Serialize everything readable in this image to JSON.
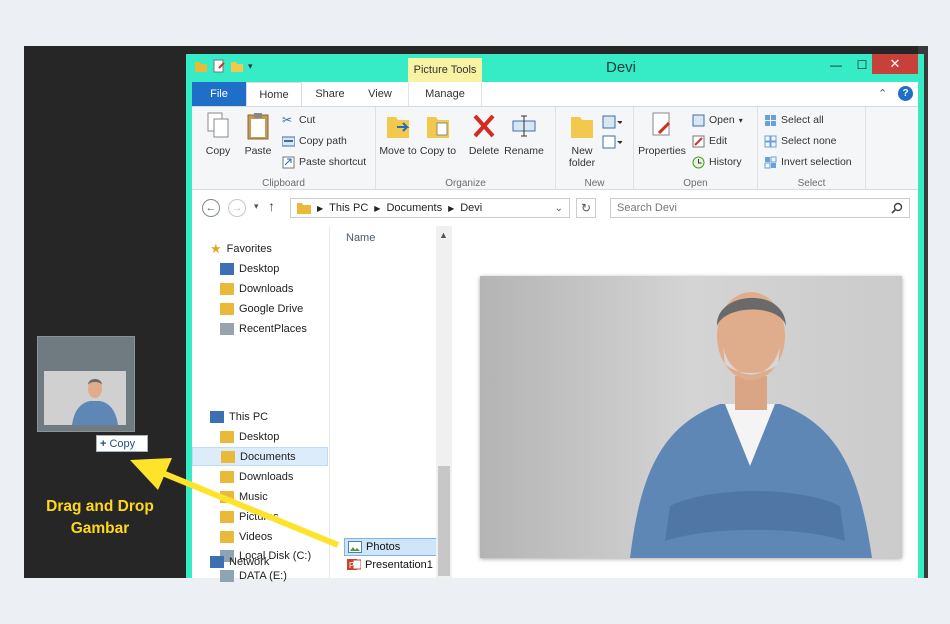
{
  "window": {
    "title": "Devi",
    "context_tab": "Picture Tools"
  },
  "tabs": [
    "File",
    "Home",
    "Share",
    "View",
    "Manage"
  ],
  "ribbon": {
    "clipboard": {
      "label": "Clipboard",
      "copy": "Copy",
      "paste": "Paste",
      "cut": "Cut",
      "copy_path": "Copy path",
      "paste_shortcut": "Paste shortcut"
    },
    "organize": {
      "label": "Organize",
      "move_to": "Move to",
      "copy_to": "Copy to",
      "delete": "Delete",
      "rename": "Rename"
    },
    "new": {
      "label": "New",
      "new_folder": "New folder"
    },
    "open": {
      "label": "Open",
      "properties": "Properties",
      "open": "Open",
      "edit": "Edit",
      "history": "History"
    },
    "select": {
      "label": "Select",
      "select_all": "Select all",
      "select_none": "Select none",
      "invert": "Invert selection"
    }
  },
  "address": {
    "segments": [
      "This PC",
      "Documents",
      "Devi"
    ],
    "search_placeholder": "Search Devi"
  },
  "nav": {
    "favorites": "Favorites",
    "fav_items": [
      "Desktop",
      "Downloads",
      "Google Drive",
      "RecentPlaces"
    ],
    "this_pc": "This PC",
    "pc_items": [
      "Desktop",
      "Documents",
      "Downloads",
      "Music",
      "Pictures",
      "Videos",
      "Local Disk (C:)",
      "DATA (E:)"
    ],
    "network": "Network"
  },
  "files": {
    "column": "Name",
    "items": [
      "Photos",
      "Presentation1"
    ]
  },
  "drag": {
    "tooltip": "Copy",
    "caption_line1": "Drag and Drop",
    "caption_line2": "Gambar"
  },
  "colors": {
    "window_accent": "#35ecc6",
    "file_tab": "#1f6fc8",
    "annotation": "#ffd81b",
    "close_button": "#c8403a"
  }
}
